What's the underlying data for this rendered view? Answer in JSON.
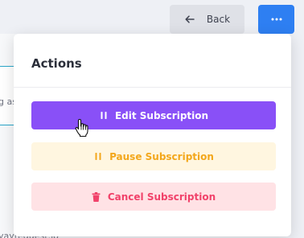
{
  "header": {
    "back_label": "Back",
    "back_icon": "arrow-left-icon",
    "more_icon": "ellipsis-icon"
  },
  "background": {
    "input_fragment": "g as",
    "footer_fragment": "yayrequest.io"
  },
  "actions_menu": {
    "title": "Actions",
    "items": [
      {
        "label": "Edit Subscription",
        "icon": "pause-icon"
      },
      {
        "label": "Pause Subscription",
        "icon": "pause-icon"
      },
      {
        "label": "Cancel Subscription",
        "icon": "trash-icon"
      }
    ]
  },
  "colors": {
    "primary": "#2e7ff2",
    "edit": "#8950f7",
    "pause": "#f3a71b",
    "cancel": "#f1426a"
  }
}
